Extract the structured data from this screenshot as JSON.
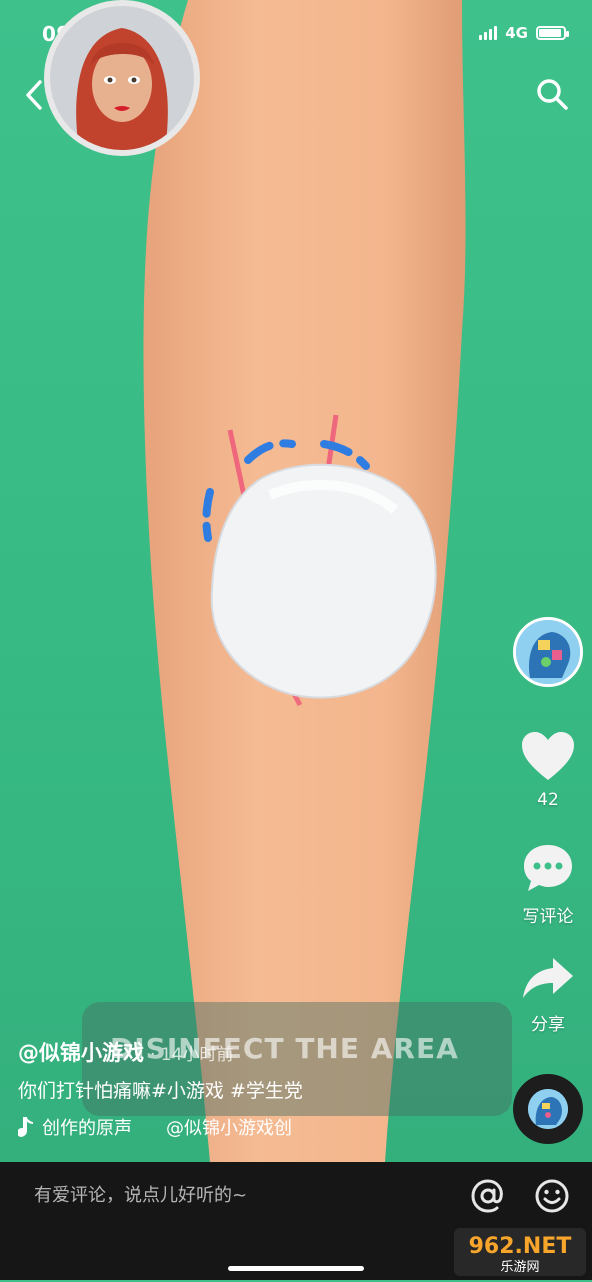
{
  "status": {
    "time": "09:47",
    "network": "4G",
    "signal_bars": 4,
    "battery_level": 0.9
  },
  "video": {
    "overlay_text": "DISINFECT THE AREA"
  },
  "actions": {
    "like_count": "42",
    "comment_label": "写评论",
    "share_label": "分享"
  },
  "post": {
    "author": "@似锦小游戏",
    "time": "· 14小时前",
    "description": "你们打针怕痛嘛#小游戏 #学生党",
    "music_title": "创作的原声",
    "music_author": "@似锦小游戏创"
  },
  "comment_bar": {
    "placeholder": "有爱评论，说点儿好听的~"
  },
  "watermark": {
    "text_main": "962.NET",
    "text_sub": "乐游网"
  },
  "icons": [
    "back-icon",
    "search-icon",
    "heart-icon",
    "comment-icon",
    "share-icon",
    "music-note-icon",
    "at-icon",
    "emoji-icon"
  ],
  "colors": {
    "background": "#3dc08a",
    "skin": "#f2b48b",
    "bottom_bar": "#161616"
  }
}
